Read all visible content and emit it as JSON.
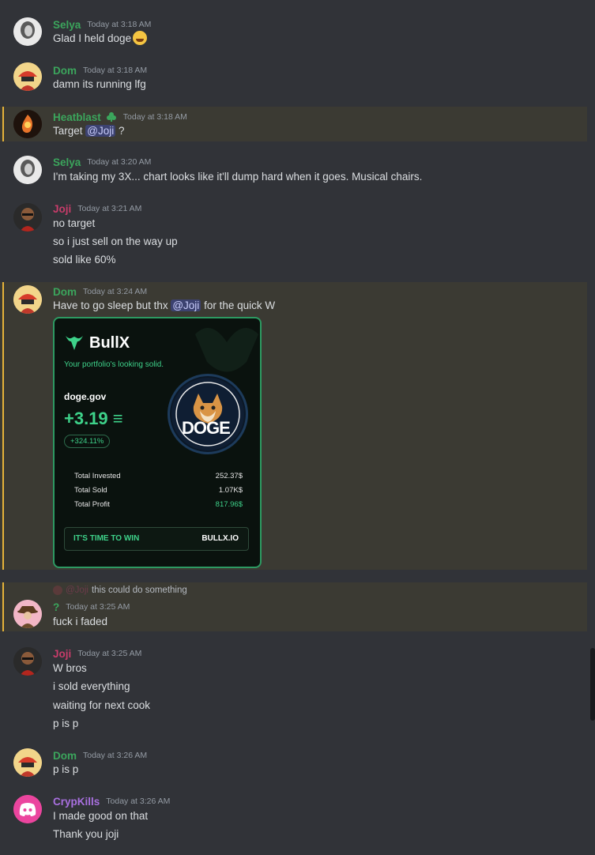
{
  "colors": {
    "background": "#313338",
    "highlight": "#3b3a33",
    "highlight_bar": "#e5b33a",
    "mention_bg": "#3c4270",
    "green_name": "#3ba55c",
    "pink_name": "#c83c6a",
    "purple_name": "#a970e0"
  },
  "messages": [
    {
      "author": "Selya",
      "time": "Today at 3:18 AM",
      "lines": [
        "Glad I held doge"
      ],
      "emoji": "rofl-emoji"
    },
    {
      "author": "Dom",
      "time": "Today at 3:18 AM",
      "lines": [
        "damn its running lfg"
      ]
    },
    {
      "author": "Heatblast",
      "time": "Today at 3:18 AM",
      "text_before": "Target ",
      "mention": "@Joji",
      "text_after": " ?",
      "badge": "club-badge-icon"
    },
    {
      "author": "Selya",
      "time": "Today at 3:20 AM",
      "lines": [
        "I'm taking my 3X... chart looks like it'll dump hard when it goes.  Musical chairs."
      ]
    },
    {
      "author": "Joji",
      "time": "Today at 3:21 AM",
      "lines": [
        "no target",
        "so i just sell on the way up",
        "sold like 60%"
      ]
    },
    {
      "author": "Dom",
      "time": "Today at 3:24 AM",
      "text_before": "Have to go sleep but thx ",
      "mention": "@Joji",
      "text_after": " for the quick W"
    },
    {
      "author": "?",
      "time": "Today at 3:25 AM",
      "reply_name": "@Joji",
      "reply_text": "this could do something",
      "lines": [
        "fuck i faded"
      ]
    },
    {
      "author": "Joji",
      "time": "Today at 3:25 AM",
      "lines": [
        "W bros",
        "i sold everything",
        "waiting for next cook",
        "p is p"
      ]
    },
    {
      "author": "Dom",
      "time": "Today at 3:26 AM",
      "lines": [
        "p is p"
      ]
    },
    {
      "author": "CrypKills",
      "time": "Today at 3:26 AM",
      "lines": [
        "I made good on that",
        "Thank you joji"
      ]
    }
  ],
  "card": {
    "brand": "BullX",
    "tagline": "Your portfolio's looking solid.",
    "token": "doge.gov",
    "profit_value": "+3.19",
    "currency_symbol": "≡",
    "percent": "+324.11%",
    "coin_text": "DOGE",
    "rows": [
      {
        "label": "Total Invested",
        "value": "252.37$"
      },
      {
        "label": "Total Sold",
        "value": "1.07K$"
      },
      {
        "label": "Total Profit",
        "value": "817.96$"
      }
    ],
    "cta_left": "IT'S TIME TO WIN",
    "cta_right": "BULLX.IO"
  }
}
